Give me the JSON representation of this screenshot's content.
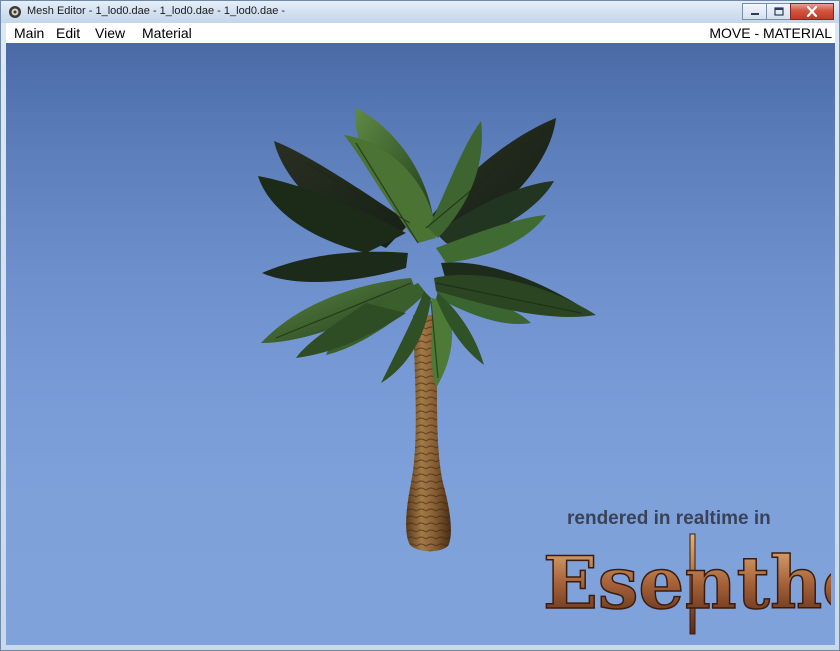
{
  "window": {
    "title": "Mesh Editor - 1_lod0.dae - 1_lod0.dae - 1_lod0.dae -"
  },
  "menu": {
    "items": [
      "Main",
      "Edit",
      "View",
      "Material"
    ],
    "mode": "MOVE - MATERIAL"
  },
  "viewport": {
    "overlay_text": "rendered in realtime in",
    "logo_text": "EsentheL"
  },
  "icons": {
    "app": "app-icon",
    "minimize": "minimize-icon",
    "maximize": "maximize-icon",
    "close": "close-icon"
  }
}
